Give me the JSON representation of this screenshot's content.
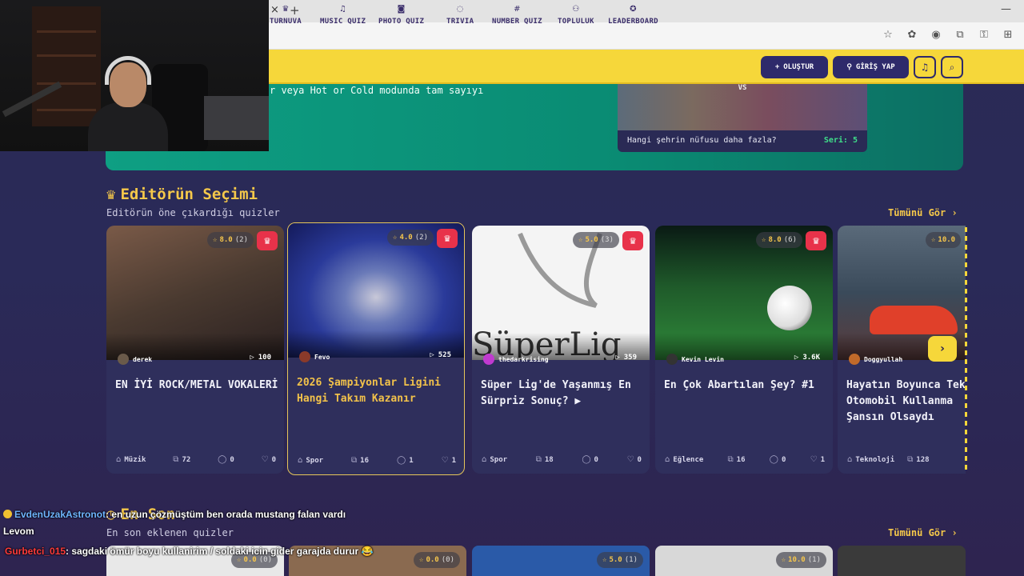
{
  "browser": {
    "tab_close": "×",
    "new_tab": "+",
    "minimize": "—",
    "icons": [
      "☆",
      "✿",
      "◉",
      "⧉",
      "⚿",
      "⊞"
    ]
  },
  "nav": {
    "items": [
      {
        "label": "TURNUVA",
        "icon": "trophy-icon",
        "glyph": "♛"
      },
      {
        "label": "MUSIC QUIZ",
        "icon": "music-icon",
        "glyph": "♫"
      },
      {
        "label": "PHOTO QUIZ",
        "icon": "camera-icon",
        "glyph": "◙"
      },
      {
        "label": "TRIVIA",
        "icon": "chat-icon",
        "glyph": "◌"
      },
      {
        "label": "NUMBER QUIZ",
        "icon": "hash-icon",
        "glyph": "#"
      },
      {
        "label": "TOPLULUK",
        "icon": "users-icon",
        "glyph": "⚇"
      },
      {
        "label": "LEADERBOARD",
        "icon": "medal-icon",
        "glyph": "✪"
      }
    ],
    "create_label": "OLUŞTUR",
    "login_label": "GİRİŞ YAP"
  },
  "hero": {
    "text": "r veya Hot or Cold modunda tam sayıyı",
    "vs": "VS",
    "question": "Hangi şehrin nüfusu daha fazla?",
    "series": "Seri: 5"
  },
  "editors_pick": {
    "title": "Editörün Seçimi",
    "subtitle": "Editörün öne çıkardığı quizler",
    "see_all": "Tümünü Gör ›",
    "cards": [
      {
        "rating": "8.0",
        "rating_count": "(2)",
        "author": "derek",
        "plays": "100",
        "title": "EN İYİ ROCK/METAL VOKALERİ",
        "category": "Müzik",
        "questions": "72",
        "comments": "0",
        "likes": "0",
        "bg": "#6a4a3a"
      },
      {
        "rating": "4.0",
        "rating_count": "(2)",
        "author": "Fevo",
        "plays": "525",
        "title": "2026 Şampiyonlar Ligini Hangi Takım Kazanır",
        "category": "Spor",
        "questions": "16",
        "comments": "1",
        "likes": "1",
        "bg": "#1e3a8a"
      },
      {
        "rating": "5.0",
        "rating_count": "(3)",
        "author": "thedarkrising",
        "plays": "359",
        "title": "Süper Lig'de Yaşanmış En Sürpriz Sonuç? ▶",
        "category": "Spor",
        "questions": "18",
        "comments": "0",
        "likes": "0",
        "bg": "#f2f2f2"
      },
      {
        "rating": "8.0",
        "rating_count": "(6)",
        "author": "Kevin Levin",
        "plays": "3.6K",
        "title": "En Çok Abartılan Şey? #1",
        "category": "Eğlence",
        "questions": "16",
        "comments": "0",
        "likes": "1",
        "bg": "#1f5a2a"
      },
      {
        "rating": "10.0",
        "rating_count": "",
        "author": "Doggyullah",
        "plays": "",
        "title": "Hayatın Boyunca Tek Otomobil Kullanma Şansın Olsaydı",
        "category": "Teknoloji",
        "questions": "128",
        "comments": "",
        "likes": "",
        "bg": "#3a4a5a"
      }
    ],
    "next_arrow": "›"
  },
  "latest": {
    "title": "En Son",
    "subtitle": "En son eklenen quizler",
    "see_all": "Tümünü Gör ›",
    "cards": [
      {
        "rating": "0.0",
        "rating_count": "(0)",
        "bg": "#e8e8e8"
      },
      {
        "rating": "0.0",
        "rating_count": "(0)",
        "bg": "#8a6a50"
      },
      {
        "rating": "5.0",
        "rating_count": "(1)",
        "bg": "#2a5aa8"
      },
      {
        "rating": "10.0",
        "rating_count": "(1)",
        "bg": "#d8d8d8"
      },
      {
        "rating": "",
        "rating_count": "",
        "bg": "#3a3a3a"
      }
    ]
  },
  "chat": {
    "line1_user": "EvdenUzakAstronot",
    "line1_msg": ": en uzun çözmüştüm ben orada mustang falan vardı",
    "line2_user": "Levom",
    "line3_user": "Gurbetci_015",
    "line3_msg": ": sagdaki ömür boyu kullanirim / soldaki icin gider garajda durur 😂"
  }
}
